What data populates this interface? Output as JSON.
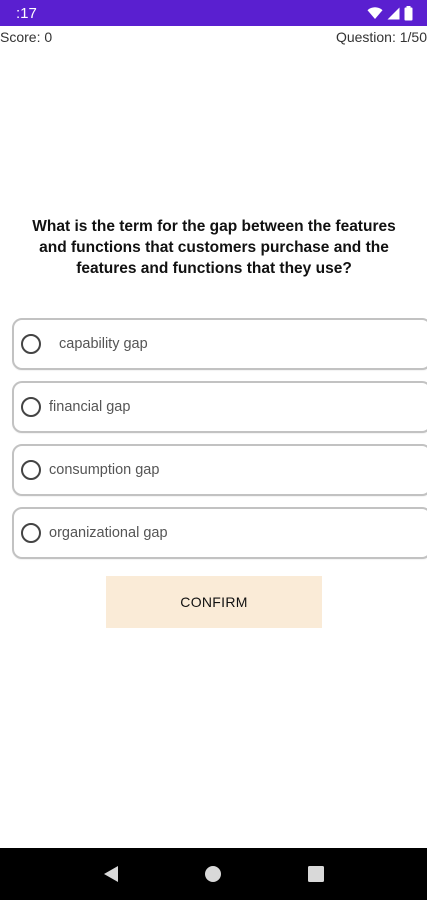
{
  "status_bar": {
    "time": ":17"
  },
  "header": {
    "score": "Score: 0",
    "question_counter": "Question: 1/50"
  },
  "quiz": {
    "question": "What is the term for the gap between the features and functions that customers purchase and the features and functions that they use?",
    "options": [
      {
        "label": "capability gap"
      },
      {
        "label": "financial gap"
      },
      {
        "label": "consumption gap"
      },
      {
        "label": "organizational gap"
      }
    ],
    "confirm_label": "CONFIRM"
  },
  "colors": {
    "status_bar": "#5a1fd0",
    "confirm_button": "#faebd7",
    "option_border": "#c2c2c2",
    "nav_bar": "#000000"
  },
  "icons": {
    "status": [
      "wifi-icon",
      "signal-icon",
      "battery-icon"
    ],
    "nav": [
      "back-icon",
      "home-icon",
      "recents-icon"
    ]
  }
}
